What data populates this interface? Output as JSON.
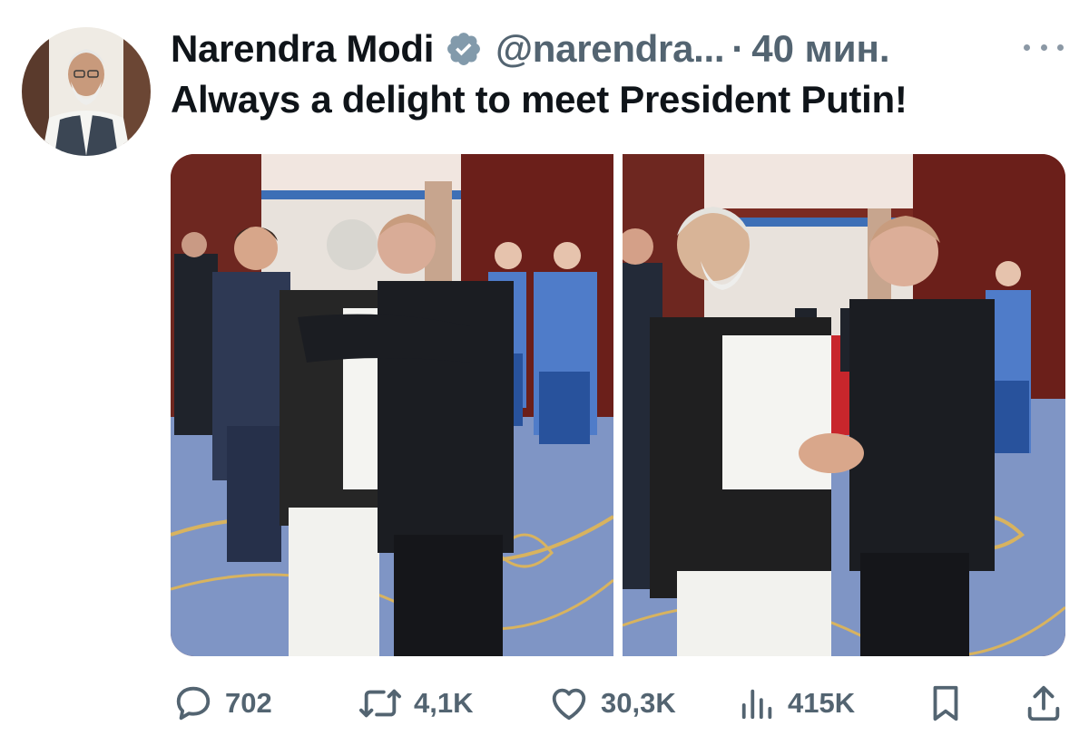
{
  "author": {
    "display_name": "Narendra Modi",
    "handle": "@narendra...",
    "separator": "·",
    "time": "40 мин.",
    "verified_icon": "verified-badge-icon"
  },
  "tweet": {
    "text": "Always a delight to meet President Putin!"
  },
  "actions": {
    "reply_count": "702",
    "retweet_count": "4,1K",
    "like_count": "30,3K",
    "views_count": "415K"
  },
  "icons": {
    "reply": "reply-bubble-icon",
    "retweet": "retweet-arrows-icon",
    "like": "heart-icon",
    "views": "bar-chart-icon",
    "bookmark": "bookmark-icon",
    "share": "share-upload-icon",
    "more": "more-dots-icon"
  },
  "colors": {
    "text_primary": "#0f1419",
    "text_secondary": "#536471",
    "badge": "#829aab"
  }
}
